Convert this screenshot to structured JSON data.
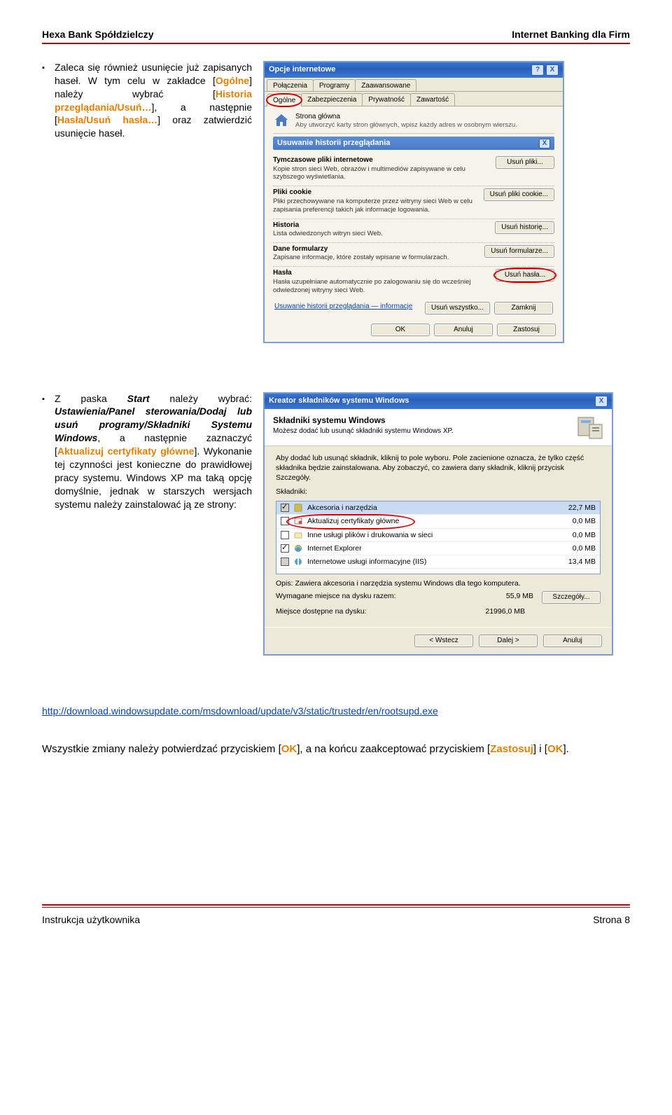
{
  "header": {
    "left": "Hexa Bank Spółdzielczy",
    "right": "Internet Banking dla Firm"
  },
  "bullet1": {
    "pre": "Zaleca się również usunięcie już zapisanych haseł. W tym celu w zakładce [",
    "tab": "Ogólne",
    "mid1": "] należy wybrać [",
    "link1": "Historia przeglądania/Usuń…",
    "mid2": "], a następnie [",
    "link2": "Hasła/Usuń hasła…",
    "post": "] oraz zatwierdzić usunięcie haseł."
  },
  "dialog1": {
    "title": "Opcje internetowe",
    "help": "?",
    "close": "X",
    "tabs": [
      "Połączenia",
      "Programy",
      "Zaawansowane"
    ],
    "tabs2": [
      "Ogólne",
      "Zabezpieczenia",
      "Prywatność",
      "Zawartość"
    ],
    "home_title": "Strona główna",
    "home_desc": "Aby utworzyć karty stron głównych, wpisz każdy adres w osobnym wierszu.",
    "sub_title": "Usuwanie historii przeglądania",
    "sub_close": "X",
    "groups": [
      {
        "h": "Tymczasowe pliki internetowe",
        "d": "Kopie stron sieci Web, obrazów i multimediów zapisywane w celu szybszego wyświetlania.",
        "b": "Usuń pliki..."
      },
      {
        "h": "Pliki cookie",
        "d": "Pliki przechowywane na komputerze przez witryny sieci Web w celu zapisania preferencji takich jak informacje logowania.",
        "b": "Usuń pliki cookie..."
      },
      {
        "h": "Historia",
        "d": "Lista odwiedzonych witryn sieci Web.",
        "b": "Usuń historię..."
      },
      {
        "h": "Dane formularzy",
        "d": "Zapisane informacje, które zostały wpisane w formularzach.",
        "b": "Usuń formularze..."
      },
      {
        "h": "Hasła",
        "d": "Hasła uzupełniane automatycznie po zalogowaniu się do wcześniej odwiedzonej witryny sieci Web.",
        "b": "Usuń hasła...",
        "circled": true
      }
    ],
    "bottom_link": "Usuwanie historii przeglądania — informacje",
    "bottom_btns": [
      "Usuń wszystko...",
      "Zamknij"
    ],
    "action_btns": [
      "OK",
      "Anuluj",
      "Zastosuj"
    ]
  },
  "bullet2": {
    "pre": "Z paska ",
    "start": "Start",
    "mid1": " należy wybrać: ",
    "path": "Ustawienia/Panel sterowania/Dodaj lub usuń programy/Składniki Systemu Windows",
    "mid2": ", a następnie zaznaczyć [",
    "link": "Aktualizuj certyfikaty główne",
    "post": "]. Wykonanie tej czynności jest konieczne do prawidłowej pracy systemu. Windows XP ma taką opcję domyślnie, jednak w starszych wersjach systemu należy zainstalować ją ze strony:"
  },
  "dialog2": {
    "title": "Kreator składników systemu Windows",
    "close": "X",
    "head": "Składniki systemu Windows",
    "head_desc": "Możesz dodać lub usunąć składniki systemu Windows XP.",
    "instr": "Aby dodać lub usunąć składnik, kliknij to pole wyboru. Pole zacienione oznacza, że tylko część składnika będzie zainstalowana. Aby zobaczyć, co zawiera dany składnik, kliknij przycisk Szczegóły.",
    "list_label": "Składniki:",
    "items": [
      {
        "chk": "half-on",
        "icon": "tools",
        "label": "Akcesoria i narzędzia",
        "size": "22,7 MB",
        "sel": true
      },
      {
        "chk": "off",
        "icon": "cert",
        "label": "Aktualizuj certyfikaty główne",
        "size": "0,0 MB",
        "circled": true
      },
      {
        "chk": "off",
        "icon": "net",
        "label": "Inne usługi plików i drukowania w sieci",
        "size": "0,0 MB"
      },
      {
        "chk": "on",
        "icon": "ie",
        "label": "Internet Explorer",
        "size": "0,0 MB"
      },
      {
        "chk": "half",
        "icon": "iis",
        "label": "Internetowe usługi informacyjne (IIS)",
        "size": "13,4 MB"
      }
    ],
    "opis_label": "Opis:",
    "opis_val": "Zawiera akcesoria i narzędzia systemu Windows dla tego komputera.",
    "req_label": "Wymagane miejsce na dysku razem:",
    "req_val": "55,9 MB",
    "avail_label": "Miejsce dostępne na dysku:",
    "avail_val": "21996,0 MB",
    "details": "Szczegóły...",
    "btns": [
      "< Wstecz",
      "Dalej >",
      "Anuluj"
    ]
  },
  "download_link": "http://download.windowsupdate.com/msdownload/update/v3/static/trustedr/en/rootsupd.exe",
  "closing": {
    "pre": "Wszystkie zmiany należy potwierdzać przyciskiem [",
    "ok": "OK",
    "mid": "], a na końcu zaakceptować przyciskiem [",
    "zastosuj": "Zastosuj",
    "mid2": "] i [",
    "ok2": "OK",
    "post": "]."
  },
  "footer": {
    "left": "Instrukcja użytkownika",
    "right": "Strona 8"
  }
}
